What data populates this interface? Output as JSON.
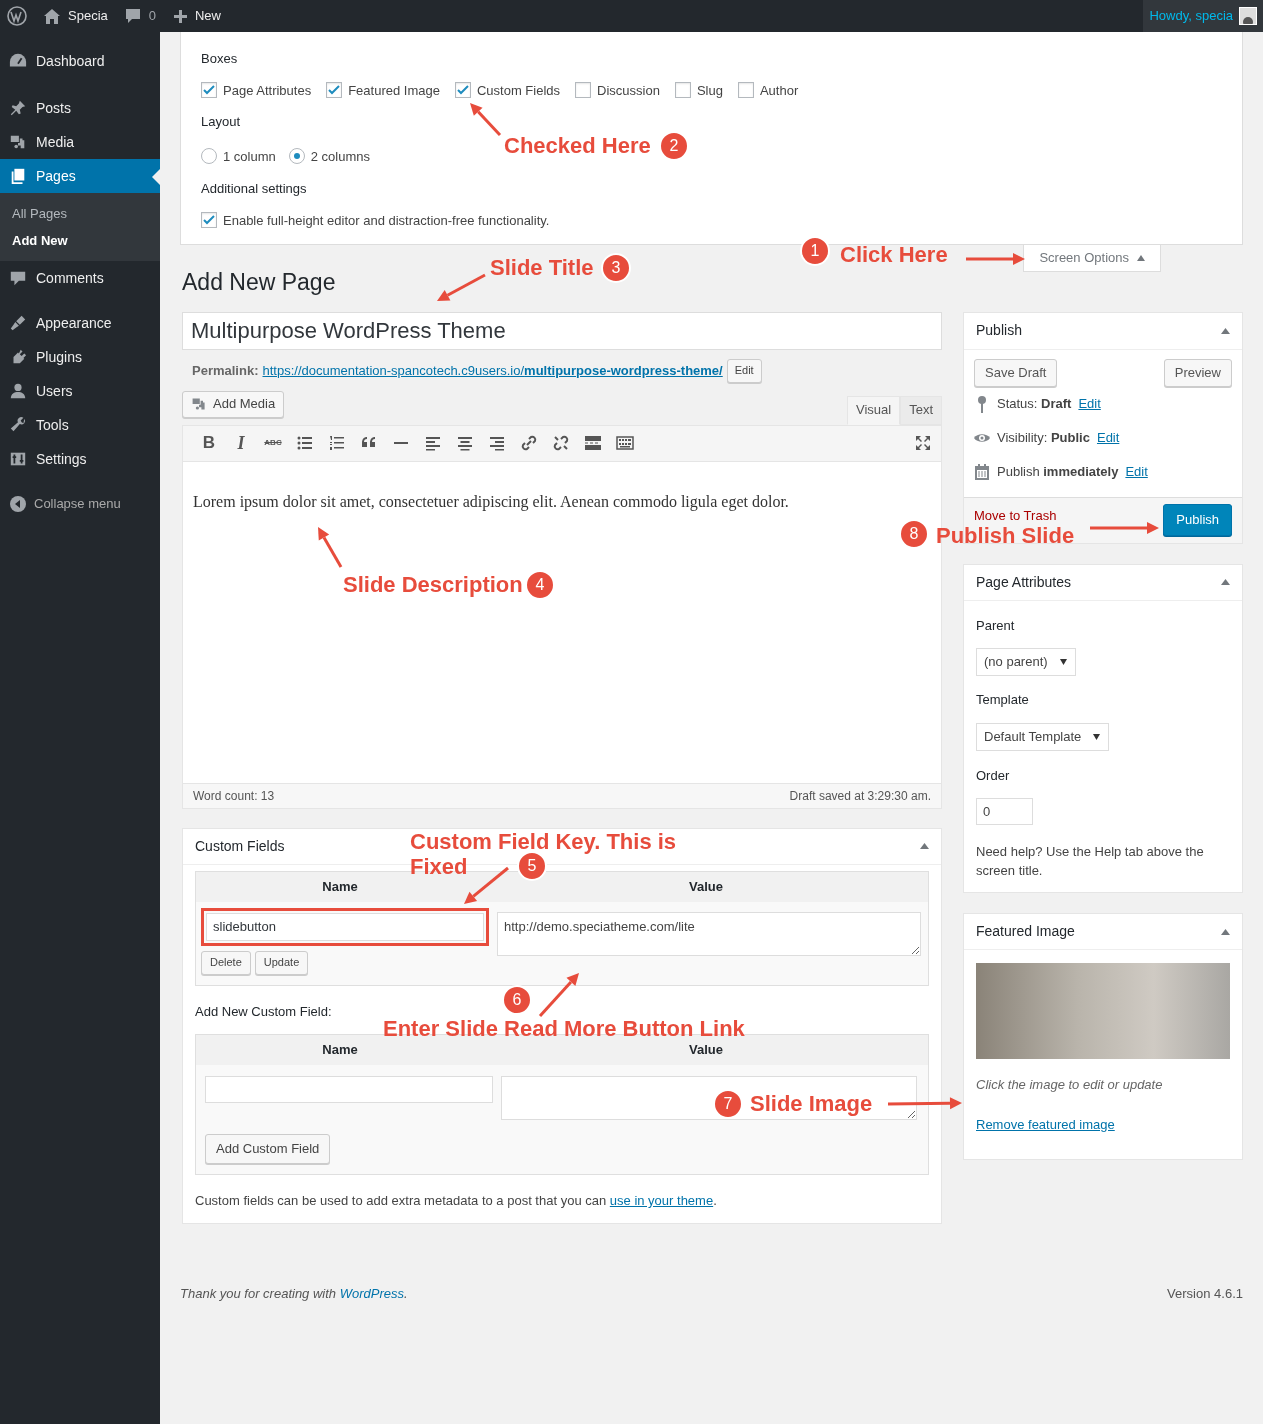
{
  "admin_bar": {
    "site": "Specia",
    "comments": "0",
    "new": "New",
    "greeting": "Howdy, specia"
  },
  "sidebar": {
    "groups": [
      [
        {
          "label": "Dashboard",
          "selected": false
        }
      ],
      [
        {
          "label": "Posts",
          "selected": false
        },
        {
          "label": "Media",
          "selected": false
        },
        {
          "label": "Pages",
          "selected": true,
          "children": [
            {
              "label": "All Pages",
              "selected": false
            },
            {
              "label": "Add New",
              "selected": true
            }
          ]
        },
        {
          "label": "Comments",
          "selected": false
        }
      ],
      [
        {
          "label": "Appearance",
          "selected": false
        },
        {
          "label": "Plugins",
          "selected": false
        },
        {
          "label": "Users",
          "selected": false
        },
        {
          "label": "Tools",
          "selected": false
        },
        {
          "label": "Settings",
          "selected": false
        }
      ]
    ],
    "collapse": "Collapse menu"
  },
  "screen_options": {
    "boxes_heading": "Boxes",
    "boxes": [
      {
        "label": "Page Attributes",
        "checked": true
      },
      {
        "label": "Featured Image",
        "checked": true
      },
      {
        "label": "Custom Fields",
        "checked": true
      },
      {
        "label": "Discussion",
        "checked": false
      },
      {
        "label": "Slug",
        "checked": false
      },
      {
        "label": "Author",
        "checked": false
      }
    ],
    "layout_heading": "Layout",
    "layout_options": [
      {
        "label": "1 column",
        "selected": false
      },
      {
        "label": "2 columns",
        "selected": true
      }
    ],
    "additional_heading": "Additional settings",
    "additional": [
      {
        "label": "Enable full-height editor and distraction-free functionality.",
        "checked": true
      }
    ],
    "toggle": "Screen Options"
  },
  "page_title": "Add New Page",
  "title_field": {
    "value": "Multipurpose WordPress Theme"
  },
  "permalink": {
    "label": "Permalink:",
    "url": "https://documentation-spancotech.c9users.io/**multipurpose-wordpress-theme/**",
    "edit": "Edit"
  },
  "editor": {
    "add_media": "Add Media",
    "tabs": [
      {
        "label": "Visual",
        "selected": true
      },
      {
        "label": "Text",
        "selected": false
      }
    ],
    "toolbar": [
      {
        "kind": "bold",
        "glyph": "B"
      },
      {
        "kind": "italic",
        "glyph": "I"
      },
      {
        "kind": "strike",
        "glyph": "ABC"
      },
      {
        "kind": "bullets"
      },
      {
        "kind": "numbers"
      },
      {
        "kind": "quote"
      },
      {
        "kind": "rule"
      },
      {
        "kind": "align-left"
      },
      {
        "kind": "align-center"
      },
      {
        "kind": "align-right"
      },
      {
        "kind": "link"
      },
      {
        "kind": "unlink"
      },
      {
        "kind": "more"
      },
      {
        "kind": "keyboard"
      }
    ],
    "content": "Lorem ipsum dolor sit amet, consectetuer adipiscing elit. Aenean commodo ligula eget dolor.",
    "word_count": "Word count: 13",
    "draft_saved": "Draft saved at 3:29:30 am."
  },
  "custom_fields": {
    "title": "Custom Fields",
    "columns": [
      "Name",
      "Value"
    ],
    "rows": [
      {
        "name": "slidebutton",
        "value": "http://demo.speciatheme.com/lite",
        "buttons": [
          "Delete",
          "Update"
        ]
      }
    ],
    "add_new_label": "Add New Custom Field:",
    "new_columns": [
      "Name",
      "Value"
    ],
    "add_button": "Add Custom Field",
    "note": "Custom fields can be used to add extra metadata to a post that you can",
    "note_link": "use in your theme",
    "note_end": "."
  },
  "publish": {
    "title": "Publish",
    "save_draft": "Save Draft",
    "preview": "Preview",
    "meta": [
      {
        "kind": "status",
        "text": "Status: **Draft**",
        "link": "Edit"
      },
      {
        "kind": "visibility",
        "text": "Visibility: **Public**",
        "link": "Edit"
      },
      {
        "kind": "schedule",
        "text": "Publish **immediately**",
        "link": "Edit"
      }
    ],
    "trash": "Move to Trash",
    "button": "Publish"
  },
  "page_attributes": {
    "title": "Page Attributes",
    "parent_label": "Parent",
    "parent": "(no parent)",
    "template_label": "Template",
    "template": "Default Template",
    "order_label": "Order",
    "order": "0",
    "help": "Need help? Use the Help tab above the screen title."
  },
  "featured_image": {
    "title": "Featured Image",
    "hint": "Click the image to edit or update",
    "remove": "Remove featured image"
  },
  "footer": {
    "thanks": "Thank you for creating with",
    "link": "WordPress",
    "end": ".",
    "version": "Version 4.6.1"
  },
  "annotations": [
    {
      "number": "1",
      "lines": [
        "Click Here"
      ]
    },
    {
      "number": "2",
      "lines": [
        "Checked Here"
      ]
    },
    {
      "number": "3",
      "lines": [
        "Slide Title"
      ]
    },
    {
      "number": "4",
      "lines": [
        "Slide Description"
      ]
    },
    {
      "number": "5",
      "lines": [
        "Custom Field Key. This is",
        "Fixed"
      ]
    },
    {
      "number": "6",
      "lines": [
        "Enter Slide Read More Button Link"
      ]
    },
    {
      "number": "7",
      "lines": [
        "Slide Image"
      ]
    },
    {
      "number": "8",
      "lines": [
        "Publish Slide"
      ]
    }
  ]
}
